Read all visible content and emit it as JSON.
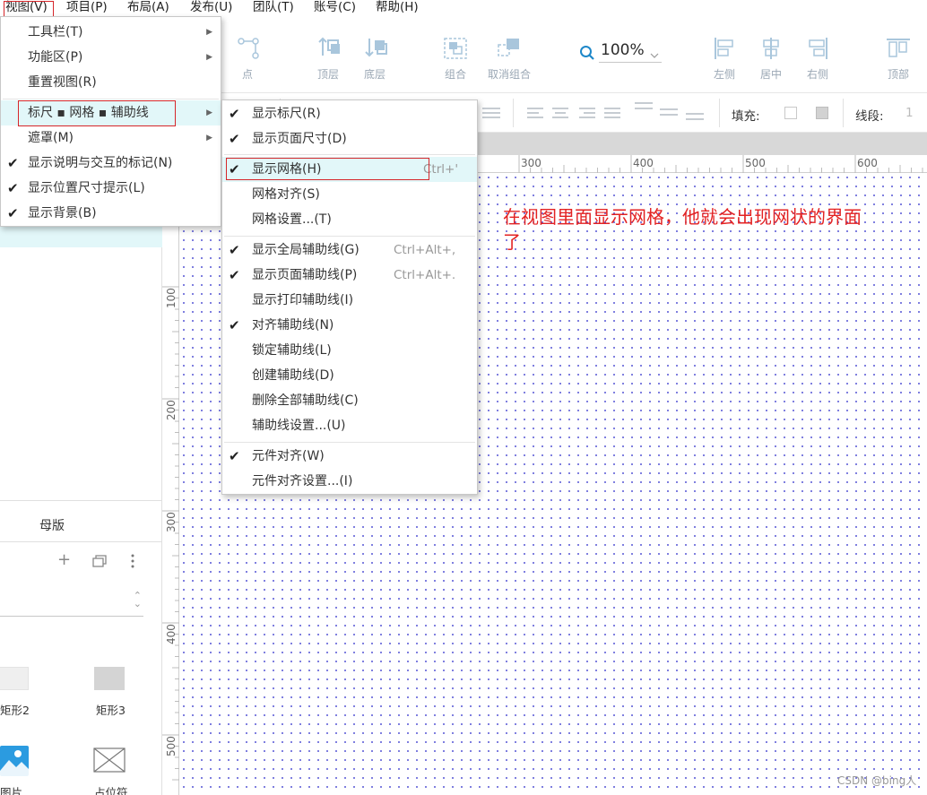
{
  "menubar": {
    "items": [
      "视图(V)",
      "项目(P)",
      "布局(A)",
      "发布(U)",
      "团队(T)",
      "账号(C)",
      "帮助(H)"
    ]
  },
  "toolbar": {
    "point_label": "点",
    "top_layer_label": "顶层",
    "bottom_layer_label": "底层",
    "group_label": "组合",
    "ungroup_label": "取消组合",
    "zoom_value": "100%",
    "align_left_label": "左侧",
    "align_center_label": "居中",
    "align_right_label": "右侧",
    "align_top_label": "顶部"
  },
  "stylebar": {
    "fill_label": "填充:",
    "segment_label": "线段:",
    "segment_value": "1"
  },
  "view_menu": {
    "items": [
      {
        "label": "工具栏(T)",
        "checked": false,
        "submenu": true
      },
      {
        "label": "功能区(P)",
        "checked": false,
        "submenu": true
      },
      {
        "label": "重置视图(R)",
        "checked": false,
        "submenu": false
      },
      {
        "label": "标尺 ▪ 网格 ▪ 辅助线",
        "checked": false,
        "submenu": true
      },
      {
        "label": "遮罩(M)",
        "checked": false,
        "submenu": true
      },
      {
        "label": "显示说明与交互的标记(N)",
        "checked": true,
        "submenu": false
      },
      {
        "label": "显示位置尺寸提示(L)",
        "checked": true,
        "submenu": false
      },
      {
        "label": "显示背景(B)",
        "checked": true,
        "submenu": false
      }
    ]
  },
  "grid_menu": {
    "items": [
      {
        "label": "显示标尺(R)",
        "checked": true,
        "shortcut": ""
      },
      {
        "label": "显示页面尺寸(D)",
        "checked": true,
        "shortcut": ""
      },
      {
        "label": "显示网格(H)",
        "checked": true,
        "shortcut": "Ctrl+'"
      },
      {
        "label": "网格对齐(S)",
        "checked": false,
        "shortcut": ""
      },
      {
        "label": "网格设置...(T)",
        "checked": false,
        "shortcut": ""
      },
      {
        "label": "显示全局辅助线(G)",
        "checked": true,
        "shortcut": "Ctrl+Alt+,"
      },
      {
        "label": "显示页面辅助线(P)",
        "checked": true,
        "shortcut": "Ctrl+Alt+."
      },
      {
        "label": "显示打印辅助线(I)",
        "checked": false,
        "shortcut": ""
      },
      {
        "label": "对齐辅助线(N)",
        "checked": true,
        "shortcut": ""
      },
      {
        "label": "锁定辅助线(L)",
        "checked": false,
        "shortcut": ""
      },
      {
        "label": "创建辅助线(D)",
        "checked": false,
        "shortcut": ""
      },
      {
        "label": "删除全部辅助线(C)",
        "checked": false,
        "shortcut": ""
      },
      {
        "label": "辅助线设置...(U)",
        "checked": false,
        "shortcut": ""
      },
      {
        "label": "元件对齐(W)",
        "checked": true,
        "shortcut": ""
      },
      {
        "label": "元件对齐设置...(I)",
        "checked": false,
        "shortcut": ""
      }
    ]
  },
  "left_panel": {
    "masters_tab": "母版",
    "widgets": [
      "矩形2",
      "矩形3",
      "图片",
      "占位符"
    ]
  },
  "ruler": {
    "top_labels": [
      "300",
      "400",
      "500",
      "600"
    ],
    "left_labels": [
      "100",
      "200",
      "300",
      "400",
      "500"
    ]
  },
  "annotation": "在视图里面显示网格，他就会出现网状的界面了",
  "watermark": "CSDN @bing人",
  "colors": {
    "highlight_box": "#d6262a",
    "menu_active_bg": "#e2f7f9",
    "grid_dot": "#5b5bd6",
    "annotation_text": "#e32222"
  }
}
